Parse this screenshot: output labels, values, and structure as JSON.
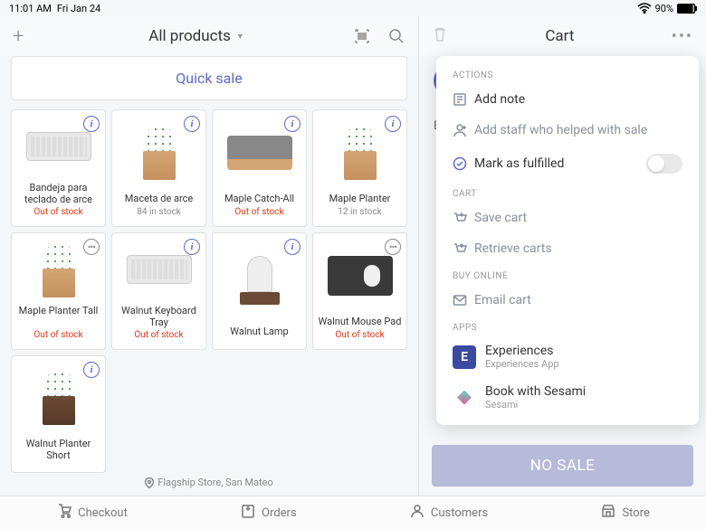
{
  "status": {
    "time": "11:01 AM",
    "date": "Fri Jan 24",
    "battery": "90%"
  },
  "toolbar": {
    "title": "All products"
  },
  "quick_sale": "Quick sale",
  "products": [
    {
      "name": "Bandeja para teclado de arce",
      "stock": "Out of stock",
      "stock_class": "out",
      "badge": "i",
      "img": "keyboard"
    },
    {
      "name": "Maceta de arce",
      "stock": "84 in stock",
      "stock_class": "in",
      "badge": "i",
      "img": "planter-maple"
    },
    {
      "name": "Maple Catch-All",
      "stock": "Out of stock",
      "stock_class": "out",
      "badge": "i",
      "img": "catchall"
    },
    {
      "name": "Maple Planter",
      "stock": "12 in stock",
      "stock_class": "in",
      "badge": "i",
      "img": "planter-maple"
    },
    {
      "name": "Maple Planter Tall",
      "stock": "Out of stock",
      "stock_class": "out",
      "badge": "dots",
      "img": "planter-maple"
    },
    {
      "name": "Walnut Keyboard Tray",
      "stock": "Out of stock",
      "stock_class": "out",
      "badge": "i",
      "img": "keyboard"
    },
    {
      "name": "Walnut Lamp",
      "stock": "",
      "stock_class": "in",
      "badge": "i",
      "img": "lamp"
    },
    {
      "name": "Walnut Mouse Pad",
      "stock": "Out of stock",
      "stock_class": "out",
      "badge": "dots",
      "img": "mousepad"
    },
    {
      "name": "Walnut Planter Short",
      "stock": "",
      "stock_class": "in",
      "badge": "i",
      "img": "planter-walnut"
    }
  ],
  "location": "Flagship Store, San Mateo",
  "cart": {
    "title": "Cart",
    "by": "By",
    "nosale": "NO SALE"
  },
  "dropdown": {
    "sections": {
      "actions": "ACTIONS",
      "cart": "CART",
      "buy": "BUY ONLINE",
      "apps": "APPS"
    },
    "add_note": "Add note",
    "add_staff": "Add staff who helped with sale",
    "fulfilled": "Mark as fulfilled",
    "save_cart": "Save cart",
    "retrieve": "Retrieve carts",
    "email": "Email cart",
    "apps": [
      {
        "name": "Experiences",
        "sub": "Experiences App",
        "color": "#3b4a9e",
        "letter": "E"
      },
      {
        "name": "Book with Sesami",
        "sub": "Sesami",
        "icon": "sesami"
      }
    ]
  },
  "nav": [
    {
      "label": "Checkout",
      "icon": "checkout"
    },
    {
      "label": "Orders",
      "icon": "orders"
    },
    {
      "label": "Customers",
      "icon": "customers"
    },
    {
      "label": "Store",
      "icon": "store"
    }
  ]
}
